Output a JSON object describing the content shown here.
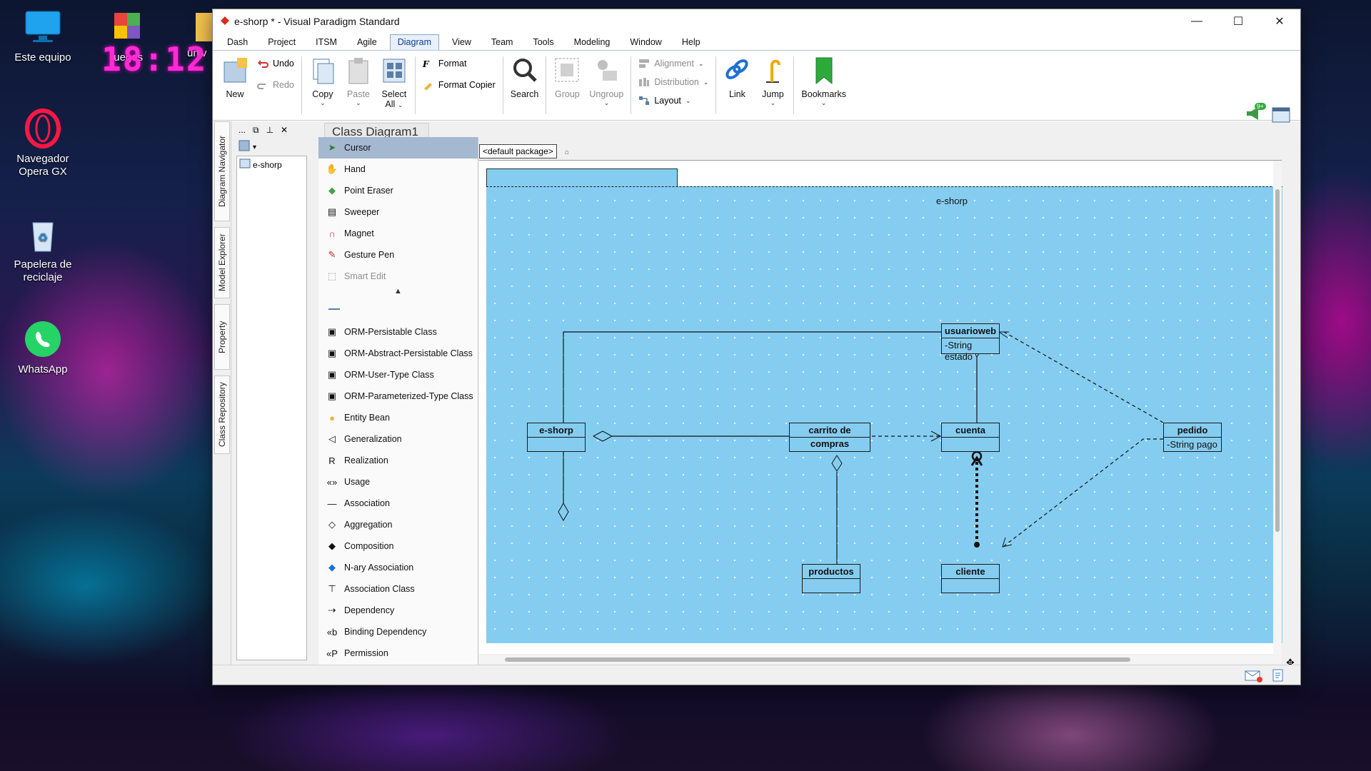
{
  "desktop": {
    "icons": [
      {
        "label": "Este equipo",
        "icon": "monitor-icon"
      },
      {
        "label": "juegos",
        "icon": "folder-apps-icon"
      },
      {
        "label": "univ",
        "icon": "folder-icon"
      },
      {
        "label": "Navegador Opera GX",
        "icon": "opera-gx-icon"
      },
      {
        "label": "Papelera de reciclaje",
        "icon": "recycle-bin-icon"
      },
      {
        "label": "WhatsApp",
        "icon": "whatsapp-icon"
      }
    ],
    "clock": "18:12"
  },
  "window": {
    "title": "e-shorp * - Visual Paradigm Standard",
    "controls": {
      "minimize": "—",
      "maximize": "☐",
      "close": "✕"
    }
  },
  "menu": [
    "Dash",
    "Project",
    "ITSM",
    "Agile",
    "Diagram",
    "View",
    "Team",
    "Tools",
    "Modeling",
    "Window",
    "Help"
  ],
  "menu_active": "Diagram",
  "ribbon": {
    "new": "New",
    "undo": "Undo",
    "redo": "Redo",
    "copy": "Copy",
    "paste": "Paste",
    "select_all_1": "Select",
    "select_all_2": "All",
    "format": "Format",
    "format_copier": "Format Copier",
    "search": "Search",
    "group": "Group",
    "ungroup": "Ungroup",
    "alignment": "Alignment",
    "distribution": "Distribution",
    "layout": "Layout",
    "link": "Link",
    "jump": "Jump",
    "bookmarks": "Bookmarks",
    "notification_badge": "9+"
  },
  "side_tabs": [
    "Diagram Navigator",
    "Model Explorer",
    "Property",
    "Class Repository"
  ],
  "navigator": {
    "tree_item": "e-shorp",
    "tools": [
      "...",
      "⧉",
      "⊥",
      "✕"
    ]
  },
  "diagram_tab": "Class Diagram1",
  "package_label": "<default package>",
  "palette": {
    "tools": [
      {
        "label": "Cursor",
        "icon": "cursor-icon",
        "state": "selected"
      },
      {
        "label": "Hand",
        "icon": "hand-icon"
      },
      {
        "label": "Point Eraser",
        "icon": "eraser-icon"
      },
      {
        "label": "Sweeper",
        "icon": "sweeper-icon"
      },
      {
        "label": "Magnet",
        "icon": "magnet-icon"
      },
      {
        "label": "Gesture Pen",
        "icon": "pen-icon"
      },
      {
        "label": "Smart Edit",
        "icon": "smart-edit-icon",
        "state": "disabled"
      }
    ],
    "elements": [
      {
        "label": "ORM-Persistable Class",
        "icon": "orm-class-icon"
      },
      {
        "label": "ORM-Abstract-Persistable Class",
        "icon": "orm-class-icon"
      },
      {
        "label": "ORM-User-Type Class",
        "icon": "orm-class-icon"
      },
      {
        "label": "ORM-Parameterized-Type Class",
        "icon": "orm-class-icon"
      },
      {
        "label": "Entity Bean",
        "icon": "entity-bean-icon"
      },
      {
        "label": "Generalization",
        "icon": "generalization-icon"
      },
      {
        "label": "Realization",
        "icon": "realization-icon"
      },
      {
        "label": "Usage",
        "icon": "usage-icon"
      },
      {
        "label": "Association",
        "icon": "association-icon"
      },
      {
        "label": "Aggregation",
        "icon": "aggregation-icon"
      },
      {
        "label": "Composition",
        "icon": "composition-icon"
      },
      {
        "label": "N-ary Association",
        "icon": "nary-association-icon"
      },
      {
        "label": "Association Class",
        "icon": "association-class-icon"
      },
      {
        "label": "Dependency",
        "icon": "dependency-icon"
      },
      {
        "label": "Binding Dependency",
        "icon": "binding-dependency-icon"
      },
      {
        "label": "Permission",
        "icon": "permission-icon"
      }
    ]
  },
  "diagram": {
    "package": "e-shorp",
    "classes": [
      {
        "id": "usuarioweb",
        "name": "usuarioweb",
        "attrs": [
          "-String estado"
        ]
      },
      {
        "id": "e-shorp",
        "name": "e-shorp",
        "attrs": []
      },
      {
        "id": "carrito",
        "name": "carrito de compras",
        "attrs": []
      },
      {
        "id": "cuenta",
        "name": "cuenta",
        "attrs": []
      },
      {
        "id": "pedido",
        "name": "pedido",
        "attrs": [
          "-String pago"
        ]
      },
      {
        "id": "productos",
        "name": "productos",
        "attrs": []
      },
      {
        "id": "cliente",
        "name": "cliente",
        "attrs": []
      }
    ],
    "relations": [
      {
        "from": "usuarioweb",
        "to": "e-shorp",
        "kind": "aggregation"
      },
      {
        "from": "cuenta",
        "to": "usuarioweb",
        "kind": "aggregation"
      },
      {
        "from": "carrito",
        "to": "e-shorp",
        "kind": "aggregation"
      },
      {
        "from": "carrito",
        "to": "cuenta",
        "kind": "dependency"
      },
      {
        "from": "pedido",
        "to": "usuarioweb",
        "kind": "dependency"
      },
      {
        "from": "pedido",
        "to": "cliente",
        "kind": "dependency"
      },
      {
        "from": "productos",
        "to": "carrito",
        "kind": "aggregation"
      },
      {
        "from": "cliente",
        "to": "cuenta",
        "kind": "containment"
      }
    ]
  }
}
